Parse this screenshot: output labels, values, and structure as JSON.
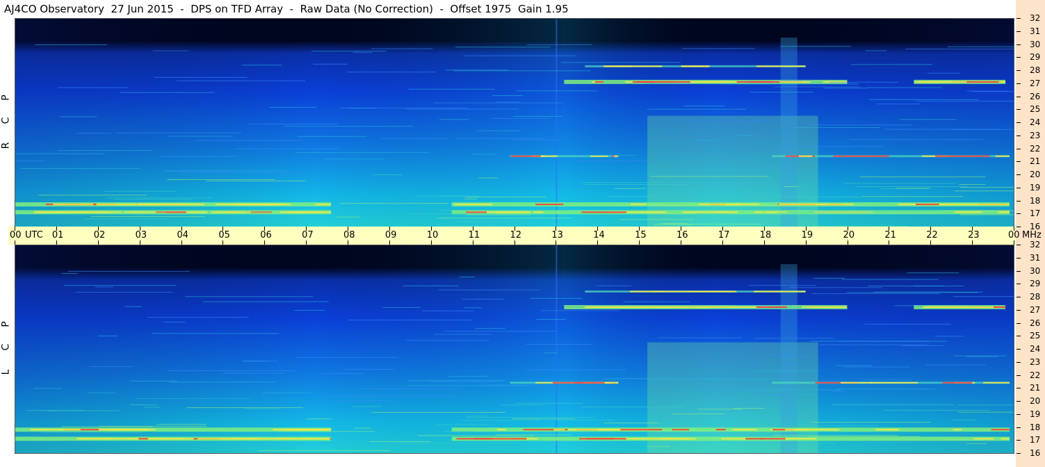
{
  "title": "AJ4CO Observatory  27 Jun 2015  -  DPS on TFD Array  -  Raw Data (No Correction)  -  Offset 1975  Gain 1.95",
  "chart_data": [
    {
      "type": "heatmap",
      "polarization_label": [
        "R",
        "C",
        "P"
      ],
      "x_tick_labels": [
        "00",
        "01",
        "02",
        "03",
        "04",
        "05",
        "06",
        "07",
        "08",
        "09",
        "10",
        "11",
        "12",
        "13",
        "14",
        "15",
        "16",
        "17",
        "18",
        "19",
        "20",
        "21",
        "22",
        "23",
        "00"
      ],
      "x_unit": "UTC",
      "xlim_hours_utc": [
        0,
        24
      ],
      "y_tick_labels": [
        "16",
        "17",
        "18",
        "19",
        "20",
        "21",
        "22",
        "23",
        "24",
        "25",
        "26",
        "27",
        "28",
        "29",
        "30",
        "31",
        "32"
      ],
      "y_unit": "MHz",
      "ylim_mhz": [
        16,
        32
      ],
      "colormap": "jet",
      "emission_bands_mhz": [
        17.1,
        17.7,
        21.4,
        27.1,
        28.3
      ]
    },
    {
      "type": "heatmap",
      "polarization_label": [
        "L",
        "C",
        "P"
      ],
      "x_tick_labels": [
        "00",
        "01",
        "02",
        "03",
        "04",
        "05",
        "06",
        "07",
        "08",
        "09",
        "10",
        "11",
        "12",
        "13",
        "14",
        "15",
        "16",
        "17",
        "18",
        "19",
        "20",
        "21",
        "22",
        "23",
        "00"
      ],
      "x_unit": "UTC",
      "xlim_hours_utc": [
        0,
        24
      ],
      "y_tick_labels": [
        "16",
        "17",
        "18",
        "19",
        "20",
        "21",
        "22",
        "23",
        "24",
        "25",
        "26",
        "27",
        "28",
        "29",
        "30",
        "31",
        "32"
      ],
      "y_unit": "MHz",
      "ylim_mhz": [
        16,
        32
      ],
      "colormap": "jet",
      "emission_bands_mhz": [
        17.1,
        17.8,
        21.4,
        27.2,
        28.4
      ]
    }
  ],
  "colors": {
    "background_dark": "#000620",
    "background_blue": "#0a3fd8",
    "background_cyan": "#12b8e8",
    "emission_green": "#7ff07f",
    "emission_yellow": "#f5e84a",
    "emission_red": "#ff3a3a",
    "axis_band": "#ffffc0",
    "right_strip": "#fde3c8"
  }
}
